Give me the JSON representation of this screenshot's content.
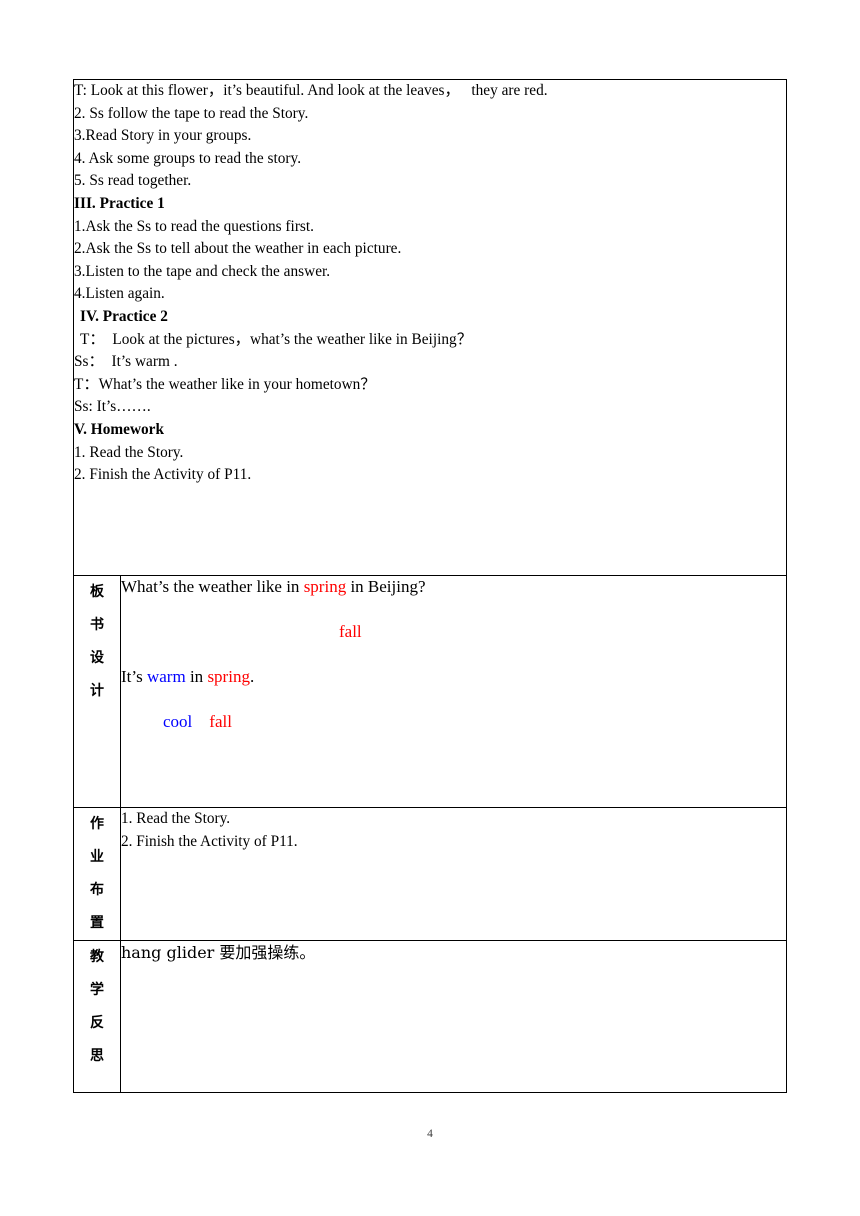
{
  "document": {
    "page_number": "4",
    "colors": {
      "red": "#ff0000",
      "blue": "#0000ff",
      "text": "#000000",
      "border": "#000000"
    }
  },
  "procedure": {
    "lines": [
      {
        "text": "T: Look at this flower，it’s beautiful. And look at the leaves，   they are red.",
        "bold": false,
        "indent": false
      },
      {
        "text": "2. Ss follow the tape to read the Story.",
        "bold": false,
        "indent": false
      },
      {
        "text": "3.Read Story in your groups.",
        "bold": false,
        "indent": false
      },
      {
        "text": "4. Ask some groups to read the story.",
        "bold": false,
        "indent": false
      },
      {
        "text": "5. Ss read together.",
        "bold": false,
        "indent": false
      },
      {
        "text": "III. Practice 1",
        "bold": true,
        "indent": false
      },
      {
        "text": "1.Ask the Ss to read the questions first.",
        "bold": false,
        "indent": false
      },
      {
        "text": "2.Ask the Ss to tell about the weather in each picture.",
        "bold": false,
        "indent": false
      },
      {
        "text": "3.Listen to the tape and check the answer.",
        "bold": false,
        "indent": false
      },
      {
        "text": "4.Listen again.",
        "bold": false,
        "indent": false
      },
      {
        "text": "IV. Practice 2",
        "bold": true,
        "indent": true
      },
      {
        "text": "T：  Look at the pictures，what’s the weather like in Beijing？",
        "bold": false,
        "indent": true
      },
      {
        "text": "Ss：  It’s warm .",
        "bold": false,
        "indent": false
      },
      {
        "text": "T：What’s the weather like in your hometown？",
        "bold": false,
        "indent": false
      },
      {
        "text": "Ss: It’s…….",
        "bold": false,
        "indent": false
      },
      {
        "text": "V. Homework",
        "bold": true,
        "indent": false
      },
      {
        "text": "1. Read the Story.",
        "bold": false,
        "indent": false
      },
      {
        "text": "2. Finish the Activity of P11.",
        "bold": false,
        "indent": false
      }
    ]
  },
  "blackboard": {
    "label": "板书设计",
    "label_chars": [
      "板",
      "书",
      "设",
      "计"
    ],
    "line1": {
      "part1": "What’s the weather like in ",
      "highlight": "spring",
      "part2": " in Beijing?"
    },
    "line2": {
      "alt": "fall"
    },
    "line3": {
      "part1": "It’s ",
      "word_blue": "warm",
      "part2": " in ",
      "word_red": "spring",
      "part3": "."
    },
    "line4": {
      "word_blue": "cool",
      "gap": "    ",
      "word_red": "fall"
    }
  },
  "homework": {
    "label": "作业布置",
    "label_chars": [
      "作",
      "业",
      "布",
      "置"
    ],
    "lines": [
      "1. Read the Story.",
      "2. Finish the Activity of P11."
    ]
  },
  "reflection": {
    "label": "教学反思",
    "label_chars": [
      "教",
      "学",
      "反",
      "思"
    ],
    "lines": [
      "hang glider 要加强操练。"
    ]
  }
}
